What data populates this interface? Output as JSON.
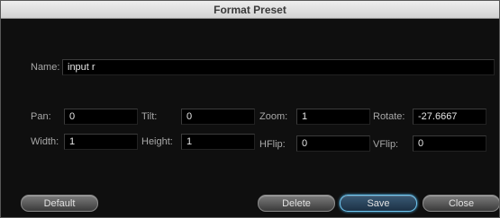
{
  "dialog": {
    "title": "Format Preset"
  },
  "name": {
    "label": "Name:",
    "value": "input r"
  },
  "fields": {
    "pan": {
      "label": "Pan:",
      "value": "0"
    },
    "tilt": {
      "label": "Tilt:",
      "value": "0"
    },
    "zoom": {
      "label": "Zoom:",
      "value": "1"
    },
    "rotate": {
      "label": "Rotate:",
      "value": "-27.6667"
    },
    "width": {
      "label": "Width:",
      "value": "1"
    },
    "height": {
      "label": "Height:",
      "value": "1"
    },
    "hflip": {
      "label": "HFlip:",
      "value": "0"
    },
    "vflip": {
      "label": "VFlip:",
      "value": "0"
    }
  },
  "buttons": {
    "default": "Default",
    "delete": "Delete",
    "save": "Save",
    "close": "Close"
  }
}
